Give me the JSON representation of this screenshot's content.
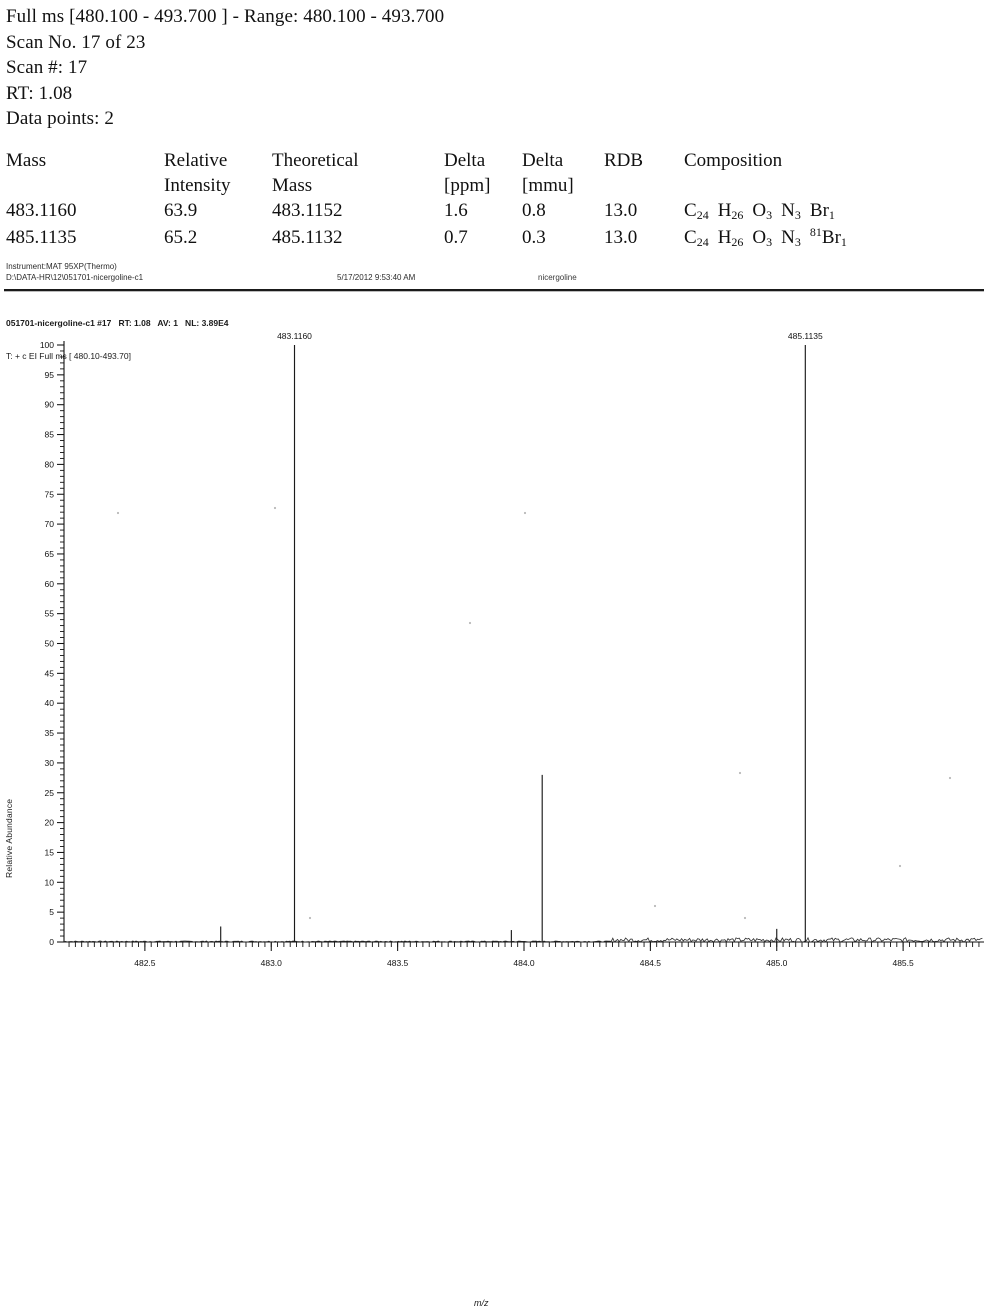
{
  "report": {
    "lines": [
      "Full ms [480.100 - 493.700 ] - Range: 480.100 - 493.700",
      "Scan No. 17 of 23",
      "Scan #: 17",
      "RT: 1.08",
      "Data points: 2"
    ]
  },
  "table": {
    "headers_row1": [
      "Mass",
      "Relative",
      "Theoretical",
      "Delta",
      "Delta",
      "RDB",
      "Composition"
    ],
    "headers_row2": [
      "",
      "Intensity",
      "Mass",
      "[ppm]",
      "[mmu]",
      "",
      ""
    ],
    "rows": [
      {
        "mass": "483.1160",
        "relative_intensity": "63.9",
        "theoretical_mass": "483.1152",
        "delta_ppm": "1.6",
        "delta_mmu": "0.8",
        "rdb": "13.0",
        "composition": [
          {
            "iso": "",
            "sym": "C",
            "n": "24"
          },
          {
            "iso": "",
            "sym": "H",
            "n": "26"
          },
          {
            "iso": "",
            "sym": "O",
            "n": "3"
          },
          {
            "iso": "",
            "sym": "N",
            "n": "3"
          },
          {
            "iso": "",
            "sym": "Br",
            "n": "1"
          }
        ]
      },
      {
        "mass": "485.1135",
        "relative_intensity": "65.2",
        "theoretical_mass": "485.1132",
        "delta_ppm": "0.7",
        "delta_mmu": "0.3",
        "rdb": "13.0",
        "composition": [
          {
            "iso": "",
            "sym": "C",
            "n": "24"
          },
          {
            "iso": "",
            "sym": "H",
            "n": "26"
          },
          {
            "iso": "",
            "sym": "O",
            "n": "3"
          },
          {
            "iso": "",
            "sym": "N",
            "n": "3"
          },
          {
            "iso": "81",
            "sym": "Br",
            "n": "1"
          }
        ]
      }
    ]
  },
  "instrument": {
    "name": "Instrument:MAT 95XP(Thermo)",
    "path": "D:\\DATA-HR\\12\\051701-nicergoline-c1",
    "datetime": "5/17/2012 9:53:40 AM",
    "sample": "nicergoline"
  },
  "scan_description": {
    "line1": "051701-nicergoline-c1 #17   RT: 1.08   AV: 1   NL: 3.89E4",
    "line2": "T: + c EI Full ms [ 480.10-493.70]"
  },
  "chart_data": {
    "type": "line",
    "title": "",
    "xlabel": "m/z",
    "ylabel": "Relative Abundance",
    "xlim": [
      482.18,
      485.82
    ],
    "ylim": [
      0,
      100
    ],
    "xticks": [
      482.5,
      483.0,
      483.5,
      484.0,
      484.5,
      485.0,
      485.5
    ],
    "xtick_labels": [
      "482.5",
      "483.0",
      "483.5",
      "484.0",
      "484.5",
      "485.0",
      "485.5"
    ],
    "yticks": [
      0,
      5,
      10,
      15,
      20,
      25,
      30,
      35,
      40,
      45,
      50,
      55,
      60,
      65,
      70,
      75,
      80,
      85,
      90,
      95,
      100
    ],
    "ytick_labels": [
      "0",
      "5",
      "10",
      "15",
      "20",
      "25",
      "30",
      "35",
      "40",
      "45",
      "50",
      "55",
      "60",
      "65",
      "70",
      "75",
      "80",
      "85",
      "90",
      "95",
      "100"
    ],
    "grid": false,
    "peaks": [
      {
        "mz": 482.8,
        "intensity": 2.6,
        "label": ""
      },
      {
        "mz": 483.092,
        "intensity": 100.0,
        "label": "483.1160"
      },
      {
        "mz": 483.95,
        "intensity": 2.0,
        "label": ""
      },
      {
        "mz": 484.072,
        "intensity": 28.0,
        "label": ""
      },
      {
        "mz": 485.0,
        "intensity": 2.2,
        "label": ""
      },
      {
        "mz": 485.113,
        "intensity": 100.0,
        "label": "485.1135"
      }
    ]
  }
}
